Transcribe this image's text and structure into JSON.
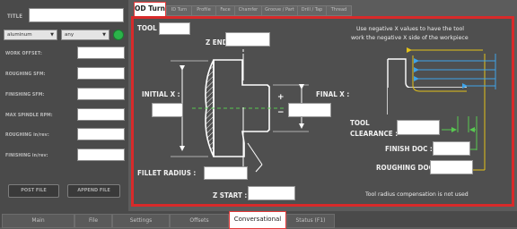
{
  "left_panel": {
    "title_label": "TITLE",
    "material_select": "aluminum",
    "second_select": "any",
    "labels": [
      "WORK OFFSET:",
      "ROUGHING SFM:",
      "FINISHING SFM:",
      "MAX SPINDLE RPM:",
      "ROUGHING in/rev:",
      "FINISHING in/rev:"
    ],
    "post_button": "POST FILE",
    "append_button": "APPEND FILE"
  },
  "tabs": [
    "OD Turn",
    "ID Turn",
    "Profile",
    "Face",
    "Chamfer",
    "Groove / Part",
    "Drill / Tap",
    "Thread"
  ],
  "diagram": {
    "tool_label": "TOOL :",
    "z_end_label": "Z END :",
    "initial_x_label": "INITIAL X :",
    "final_x_label": "FINAL X :",
    "fillet_radius_label": "FILLET RADIUS :",
    "z_start_label": "Z START :",
    "tool_clearance_label_line1": "TOOL",
    "tool_clearance_label_line2": "CLEARANCE :",
    "finish_doc_label": "FINISH DOC :",
    "roughing_doc_label": "ROUGHING DOC :",
    "plus_sign": "+",
    "minus_sign": "−",
    "note_top_line1": "Use negative X values to have the tool",
    "note_top_line2": "work the negative X side of the workpiece",
    "note_bottom": "Tool radius compensation is not used"
  },
  "bottom_tabs": [
    "Main",
    "File",
    "Settings",
    "Offsets",
    "Conversational",
    "Status (F1)"
  ],
  "colors": {
    "accent": "#d82a2a",
    "green_led": "#2bb34a",
    "guide_yellow": "#e3c21a",
    "guide_blue": "#3fa3e8",
    "guide_green": "#58c850"
  }
}
